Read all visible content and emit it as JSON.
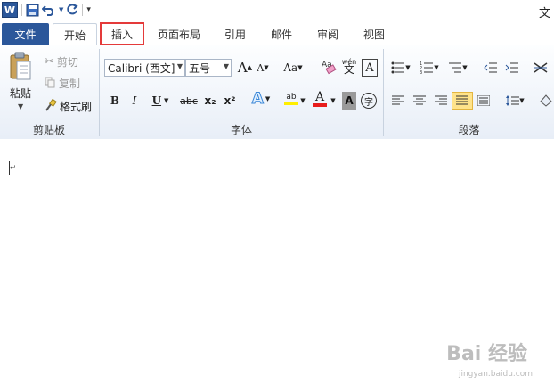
{
  "app": {
    "logo": "W",
    "title_fragment": "文"
  },
  "qat": {
    "save_icon": "save-icon",
    "undo_icon": "undo-icon",
    "redo_icon": "redo-icon",
    "customize_icon": "customize-qat-icon"
  },
  "tabs": {
    "file": "文件",
    "items": [
      "开始",
      "插入",
      "页面布局",
      "引用",
      "邮件",
      "审阅",
      "视图"
    ],
    "active": "开始",
    "highlighted": "插入"
  },
  "clipboard": {
    "paste": "粘贴",
    "cut": "剪切",
    "copy": "复制",
    "format_painter": "格式刷",
    "group": "剪贴板"
  },
  "font": {
    "family": "Calibri (西文]",
    "size": "五号",
    "grow": "A",
    "shrink": "A",
    "change_case": "Aa",
    "pinyin": "wén",
    "pinyin_char": "文",
    "border_char": "A",
    "bold": "B",
    "italic": "I",
    "underline": "U",
    "strike": "abc",
    "subscript": "x₂",
    "superscript": "x²",
    "text_effect": "A",
    "highlight": "ab",
    "font_color": "A",
    "shading": "A",
    "enclose": "字",
    "group": "字体"
  },
  "paragraph": {
    "group": "段落"
  },
  "colors": {
    "accent": "#2b579a",
    "highlight_border": "#e43a3a",
    "font_color_bar": "#e81c1c",
    "highlight_bar": "#ffee00"
  },
  "watermark": {
    "brand": "Bai 经验",
    "url": "jingyan.baidu.com"
  }
}
